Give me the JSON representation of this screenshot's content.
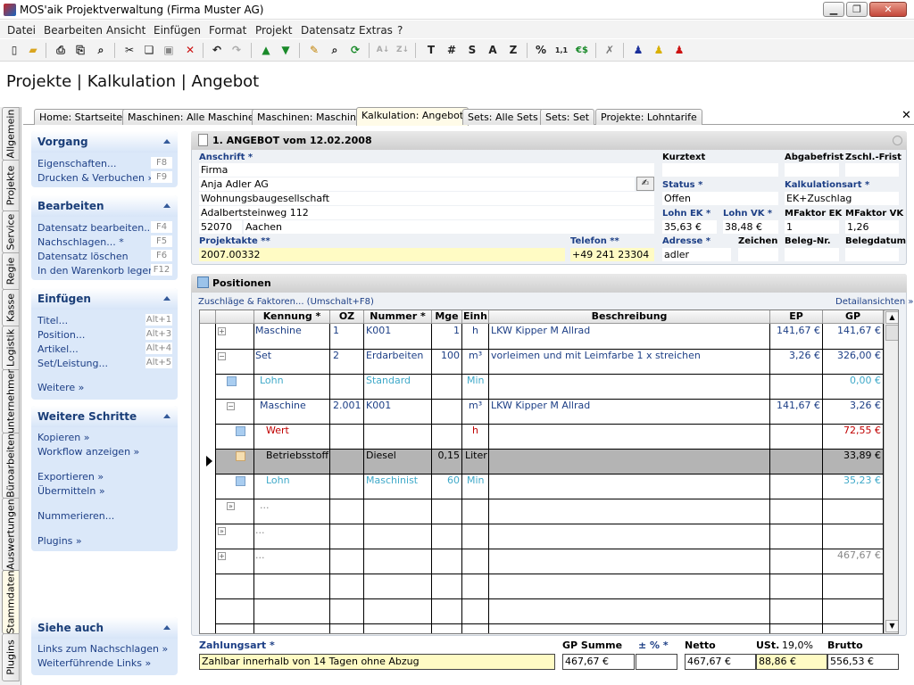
{
  "window": {
    "title": "MOS'aik Projektverwaltung (Firma Muster AG)"
  },
  "menu": [
    "Datei",
    "Bearbeiten",
    "Ansicht",
    "Einfügen",
    "Format",
    "Projekt",
    "Datensatz",
    "Extras",
    "?"
  ],
  "toolbar": {
    "t_label": "T",
    "hash_label": "#",
    "s_label": "S",
    "a_label": "A",
    "z_label": "Z",
    "percent_label": "%",
    "num_label": "1,1",
    "euro_label": "€$"
  },
  "page_title": "Projekte | Kalkulation | Angebot",
  "vtabs": [
    "Allgemein",
    "Projekte",
    "Service",
    "Regie",
    "Kasse",
    "Logistik",
    "unternehmer",
    "Büroarbeiten",
    "Auswertungen",
    "Stammdaten",
    "Plugins"
  ],
  "tabs": [
    "Home: Startseite",
    "Maschinen: Alle Maschinen",
    "Maschinen: Maschine",
    "Kalkulation: Angebot",
    "Sets: Alle Sets",
    "Sets: Set",
    "Projekte: Lohntarife"
  ],
  "taskpanel": {
    "vorgang": {
      "title": "Vorgang",
      "items": [
        {
          "label": "Eigenschaften...",
          "key": "F8"
        },
        {
          "label": "Drucken & Verbuchen »",
          "key": "F9"
        }
      ]
    },
    "bearbeiten": {
      "title": "Bearbeiten",
      "items": [
        {
          "label": "Datensatz bearbeiten...",
          "key": "F4"
        },
        {
          "label": "Nachschlagen... *",
          "key": "F5"
        },
        {
          "label": "Datensatz löschen",
          "key": "F6"
        },
        {
          "label": "In den Warenkorb legen",
          "key": "F12"
        }
      ]
    },
    "einfuegen": {
      "title": "Einfügen",
      "items": [
        {
          "label": "Titel...",
          "key": "Alt+1"
        },
        {
          "label": "Position...",
          "key": "Alt+3"
        },
        {
          "label": "Artikel...",
          "key": "Alt+4"
        },
        {
          "label": "Set/Leistung...",
          "key": "Alt+5"
        }
      ],
      "more": "Weitere »"
    },
    "schritte": {
      "title": "Weitere Schritte",
      "items": [
        "Kopieren »",
        "Workflow anzeigen »",
        "Exportieren »",
        "Übermitteln »",
        "Nummerieren...",
        "Plugins »"
      ]
    },
    "siehe": {
      "title": "Siehe auch",
      "items": [
        "Links zum Nachschlagen »",
        "Weiterführende Links »"
      ]
    }
  },
  "form": {
    "header": "1. ANGEBOT vom 12.02.2008",
    "anschrift_label": "Anschrift *",
    "address": [
      "Firma",
      "Anja Adler AG",
      "Wohnungsbaugesellschaft",
      "Adalbertsteinweg 112"
    ],
    "plz": "52070",
    "ort": "Aachen",
    "projektakte_label": "Projektakte **",
    "projektakte": "2007.00332",
    "telefon_label": "Telefon **",
    "telefon": "+49 241 23304",
    "kurztext_label": "Kurztext",
    "abgabefrist_label": "Abgabefrist",
    "zschl_label": "Zschl.-Frist",
    "status_label": "Status *",
    "status": "Offen",
    "kalkart_label": "Kalkulationsart *",
    "kalkart": "EK+Zuschlag",
    "lohnek_label": "Lohn EK *",
    "lohnek": "35,63 €",
    "lohnvk_label": "Lohn VK *",
    "lohnvk": "38,48 €",
    "mfek_label": "MFaktor EK",
    "mfek": "1",
    "mfvk_label": "MFaktor VK",
    "mfvk": "1,26",
    "adresse_label": "Adresse *",
    "adresse": "adler",
    "zeichen_label": "Zeichen",
    "belegnr_label": "Beleg-Nr.",
    "belegdatum_label": "Belegdatum"
  },
  "positions": {
    "title": "Positionen",
    "zuschlaege": "Zuschläge & Faktoren... (Umschalt+F8)",
    "detail": "Detailansichten »",
    "columns": [
      "Kennung *",
      "OZ",
      "Nummer *",
      "Mge",
      "Einh",
      "Beschreibung",
      "EP",
      "GP"
    ],
    "rows": [
      {
        "kennung": "Maschine",
        "oz": "1",
        "nummer": "K001",
        "mge": "1",
        "einh": "h",
        "beschreibung": "LKW Kipper M Allrad",
        "ep": "141,67 €",
        "gp": "141,67 €"
      },
      {
        "kennung": "Set",
        "oz": "2",
        "nummer": "Erdarbeiten",
        "mge": "100",
        "einh": "m³",
        "beschreibung": "vorleimen und mit Leimfarbe 1 x streichen",
        "ep": "3,26 €",
        "gp": "326,00 €"
      },
      {
        "kennung": "Lohn",
        "oz": "",
        "nummer": "Standard",
        "mge": "",
        "einh": "Min",
        "beschreibung": "",
        "ep": "",
        "gp": "0,00 €"
      },
      {
        "kennung": "Maschine",
        "oz": "2.001",
        "nummer": "K001",
        "mge": "",
        "einh": "m³",
        "beschreibung": "LKW Kipper M Allrad",
        "ep": "141,67 €",
        "gp": "3,26 €"
      },
      {
        "kennung": "Wert",
        "oz": "",
        "nummer": "",
        "mge": "",
        "einh": "h",
        "beschreibung": "",
        "ep": "",
        "gp": "72,55 €"
      },
      {
        "kennung": "Betriebsstoff",
        "oz": "",
        "nummer": "Diesel",
        "mge": "0,15",
        "einh": "Liter",
        "beschreibung": "",
        "ep": "",
        "gp": "33,89 €"
      },
      {
        "kennung": "Lohn",
        "oz": "",
        "nummer": "Maschinist",
        "mge": "60",
        "einh": "Min",
        "beschreibung": "",
        "ep": "",
        "gp": "35,23 €"
      },
      {
        "kennung": "...",
        "oz": "",
        "nummer": "",
        "mge": "",
        "einh": "",
        "beschreibung": "",
        "ep": "",
        "gp": ""
      },
      {
        "kennung": "...",
        "oz": "",
        "nummer": "",
        "mge": "",
        "einh": "",
        "beschreibung": "",
        "ep": "",
        "gp": ""
      },
      {
        "kennung": "...",
        "oz": "",
        "nummer": "",
        "mge": "",
        "einh": "",
        "beschreibung": "",
        "ep": "",
        "gp": "467,67 €"
      }
    ]
  },
  "totals": {
    "zahlungsart_label": "Zahlungsart *",
    "zahlungsart": "Zahlbar innerhalb von 14 Tagen ohne Abzug",
    "gpsumme_label": "GP Summe",
    "gpsumme": "467,67 €",
    "pm_label": "± % *",
    "pm": "",
    "netto_label": "Netto",
    "netto": "467,67 €",
    "ust_label": "USt.",
    "ust_rate": "19,0%",
    "ust": "88,86 €",
    "brutto_label": "Brutto",
    "brutto": "556,53 €"
  },
  "colors": {
    "link": "#1d3f86",
    "red": "#c00000",
    "cyan": "#3fa9c9",
    "selected": "#b4b4b4",
    "highlight": "#fffbc4"
  }
}
